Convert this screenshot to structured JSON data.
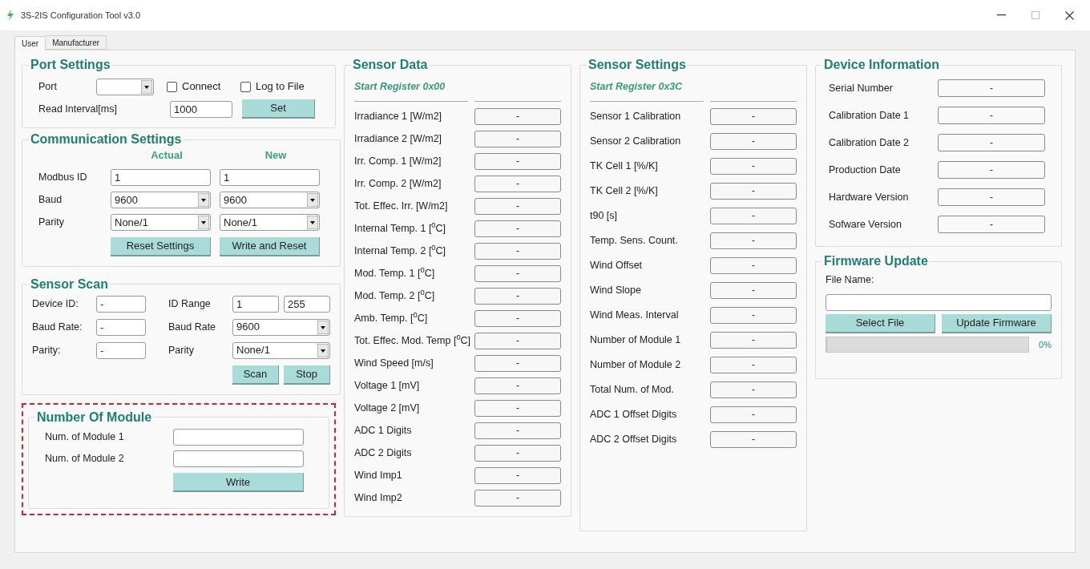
{
  "window": {
    "title": "3S-2IS Configuration Tool v3.0"
  },
  "tabs": [
    {
      "label": "User",
      "selected": true
    },
    {
      "label": "Manufacturer",
      "selected": false
    }
  ],
  "port_settings": {
    "title": "Port Settings",
    "port": {
      "label": "Port"
    },
    "checkboxes": [
      {
        "label": "Connect",
        "checked": false
      },
      {
        "label": "Log to File",
        "checked": false
      }
    ],
    "read_interval": {
      "label": "Read Interval[ms]",
      "value": "1000"
    },
    "button": "Set"
  },
  "communication_settings": {
    "title": "Communication Settings",
    "columns": [
      "Actual",
      "New"
    ],
    "rows": [
      {
        "label": "Modbus ID",
        "kind": "field",
        "actual": "1",
        "new": "1"
      },
      {
        "label": "Baud",
        "kind": "dropdown",
        "actual": "9600",
        "new": "9600"
      },
      {
        "label": "Parity",
        "kind": "dropdown",
        "actual": "None/1",
        "new": "None/1"
      }
    ],
    "buttons": [
      "Reset Settings",
      "Write and Reset"
    ]
  },
  "sensor_scan": {
    "title": "Sensor Scan",
    "readings": [
      {
        "label": "Device ID:",
        "value": "-"
      },
      {
        "label": "Baud Rate:",
        "value": "-"
      },
      {
        "label": "Parity:",
        "value": "-"
      }
    ],
    "id_range": {
      "label": "ID Range",
      "from": "1",
      "to": "255"
    },
    "baud_rate": {
      "label": "Baud Rate",
      "value": "9600"
    },
    "parity": {
      "label": "Parity",
      "value": "None/1"
    },
    "buttons": [
      "Scan",
      "Stop"
    ]
  },
  "number_of_module": {
    "title": "Number Of Module",
    "highlighted": true,
    "fields": [
      {
        "label": "Num. of Module 1"
      },
      {
        "label": "Num. of Module 2"
      }
    ],
    "button": "Write"
  },
  "sensor_data": {
    "title": "Sensor Data",
    "subtitle": "Start Register 0x00",
    "rows": [
      {
        "label": "Irradiance 1 [W/m2]",
        "value": "-"
      },
      {
        "label": "Irradiance 2 [W/m2]",
        "value": "-"
      },
      {
        "label": "Irr. Comp. 1 [W/m2]",
        "value": "-"
      },
      {
        "label": "Irr. Comp. 2 [W/m2]",
        "value": "-"
      },
      {
        "label": "Tot. Effec. Irr. [W/m2]",
        "value": "-"
      },
      {
        "label": "Internal Temp. 1 [$^{0}$C]",
        "value": "-"
      },
      {
        "label": "Internal Temp. 2 [$^{0}$C]",
        "value": "-"
      },
      {
        "label": "Mod. Temp. 1 [$^{0}$C]",
        "value": "-"
      },
      {
        "label": "Mod. Temp. 2 [$^{0}$C]",
        "value": "-"
      },
      {
        "label": "Amb. Temp. [$^{0}$C]",
        "value": "-"
      },
      {
        "label": "Tot. Effec. Mod. Temp [$^{0}$C]",
        "value": "-"
      },
      {
        "label": "Wind Speed [m/s]",
        "value": "-"
      },
      {
        "label": "Voltage 1 [mV]",
        "value": "-"
      },
      {
        "label": "Voltage 2 [mV]",
        "value": "-"
      },
      {
        "label": "ADC 1 Digits",
        "value": "-"
      },
      {
        "label": "ADC 2 Digits",
        "value": "-"
      },
      {
        "label": "Wind Imp1",
        "value": "-"
      },
      {
        "label": "Wind Imp2",
        "value": "-"
      }
    ]
  },
  "sensor_settings": {
    "title": "Sensor Settings",
    "subtitle": "Start Register 0x3C",
    "rows": [
      {
        "label": "Sensor 1 Calibration",
        "value": "-"
      },
      {
        "label": "Sensor 2 Calibration",
        "value": "-"
      },
      {
        "label": "TK Cell 1 [%/K]",
        "value": "-"
      },
      {
        "label": "TK Cell 2 [%/K]",
        "value": "-"
      },
      {
        "label": "t90 [s]",
        "value": "-"
      },
      {
        "label": "Temp. Sens. Count.",
        "value": "-"
      },
      {
        "label": "Wind Offset",
        "value": "-"
      },
      {
        "label": "Wind Slope",
        "value": "-"
      },
      {
        "label": "Wind Meas. Interval",
        "value": "-"
      },
      {
        "label": "Number of Module 1",
        "value": "-"
      },
      {
        "label": "Number of Module 2",
        "value": "-"
      },
      {
        "label": "Total Num. of Mod.",
        "value": "-"
      },
      {
        "label": "ADC 1 Offset Digits",
        "value": "-"
      },
      {
        "label": "ADC 2 Offset Digits",
        "value": "-"
      }
    ]
  },
  "device_information": {
    "title": "Device Information",
    "rows": [
      {
        "label": "Serial Number",
        "value": "-"
      },
      {
        "label": "Calibration Date 1",
        "value": "-"
      },
      {
        "label": "Calibration Date 2",
        "value": "-"
      },
      {
        "label": "Production Date",
        "value": "-"
      },
      {
        "label": "Hardware Version",
        "value": "-"
      },
      {
        "label": "Sofware Version",
        "value": "-"
      }
    ]
  },
  "firmware_update": {
    "title": "Firmware Update",
    "file_label": "File Name:",
    "buttons": [
      "Select File",
      "Update Firmware"
    ],
    "progress": {
      "level": 0,
      "reading": "0%"
    }
  }
}
